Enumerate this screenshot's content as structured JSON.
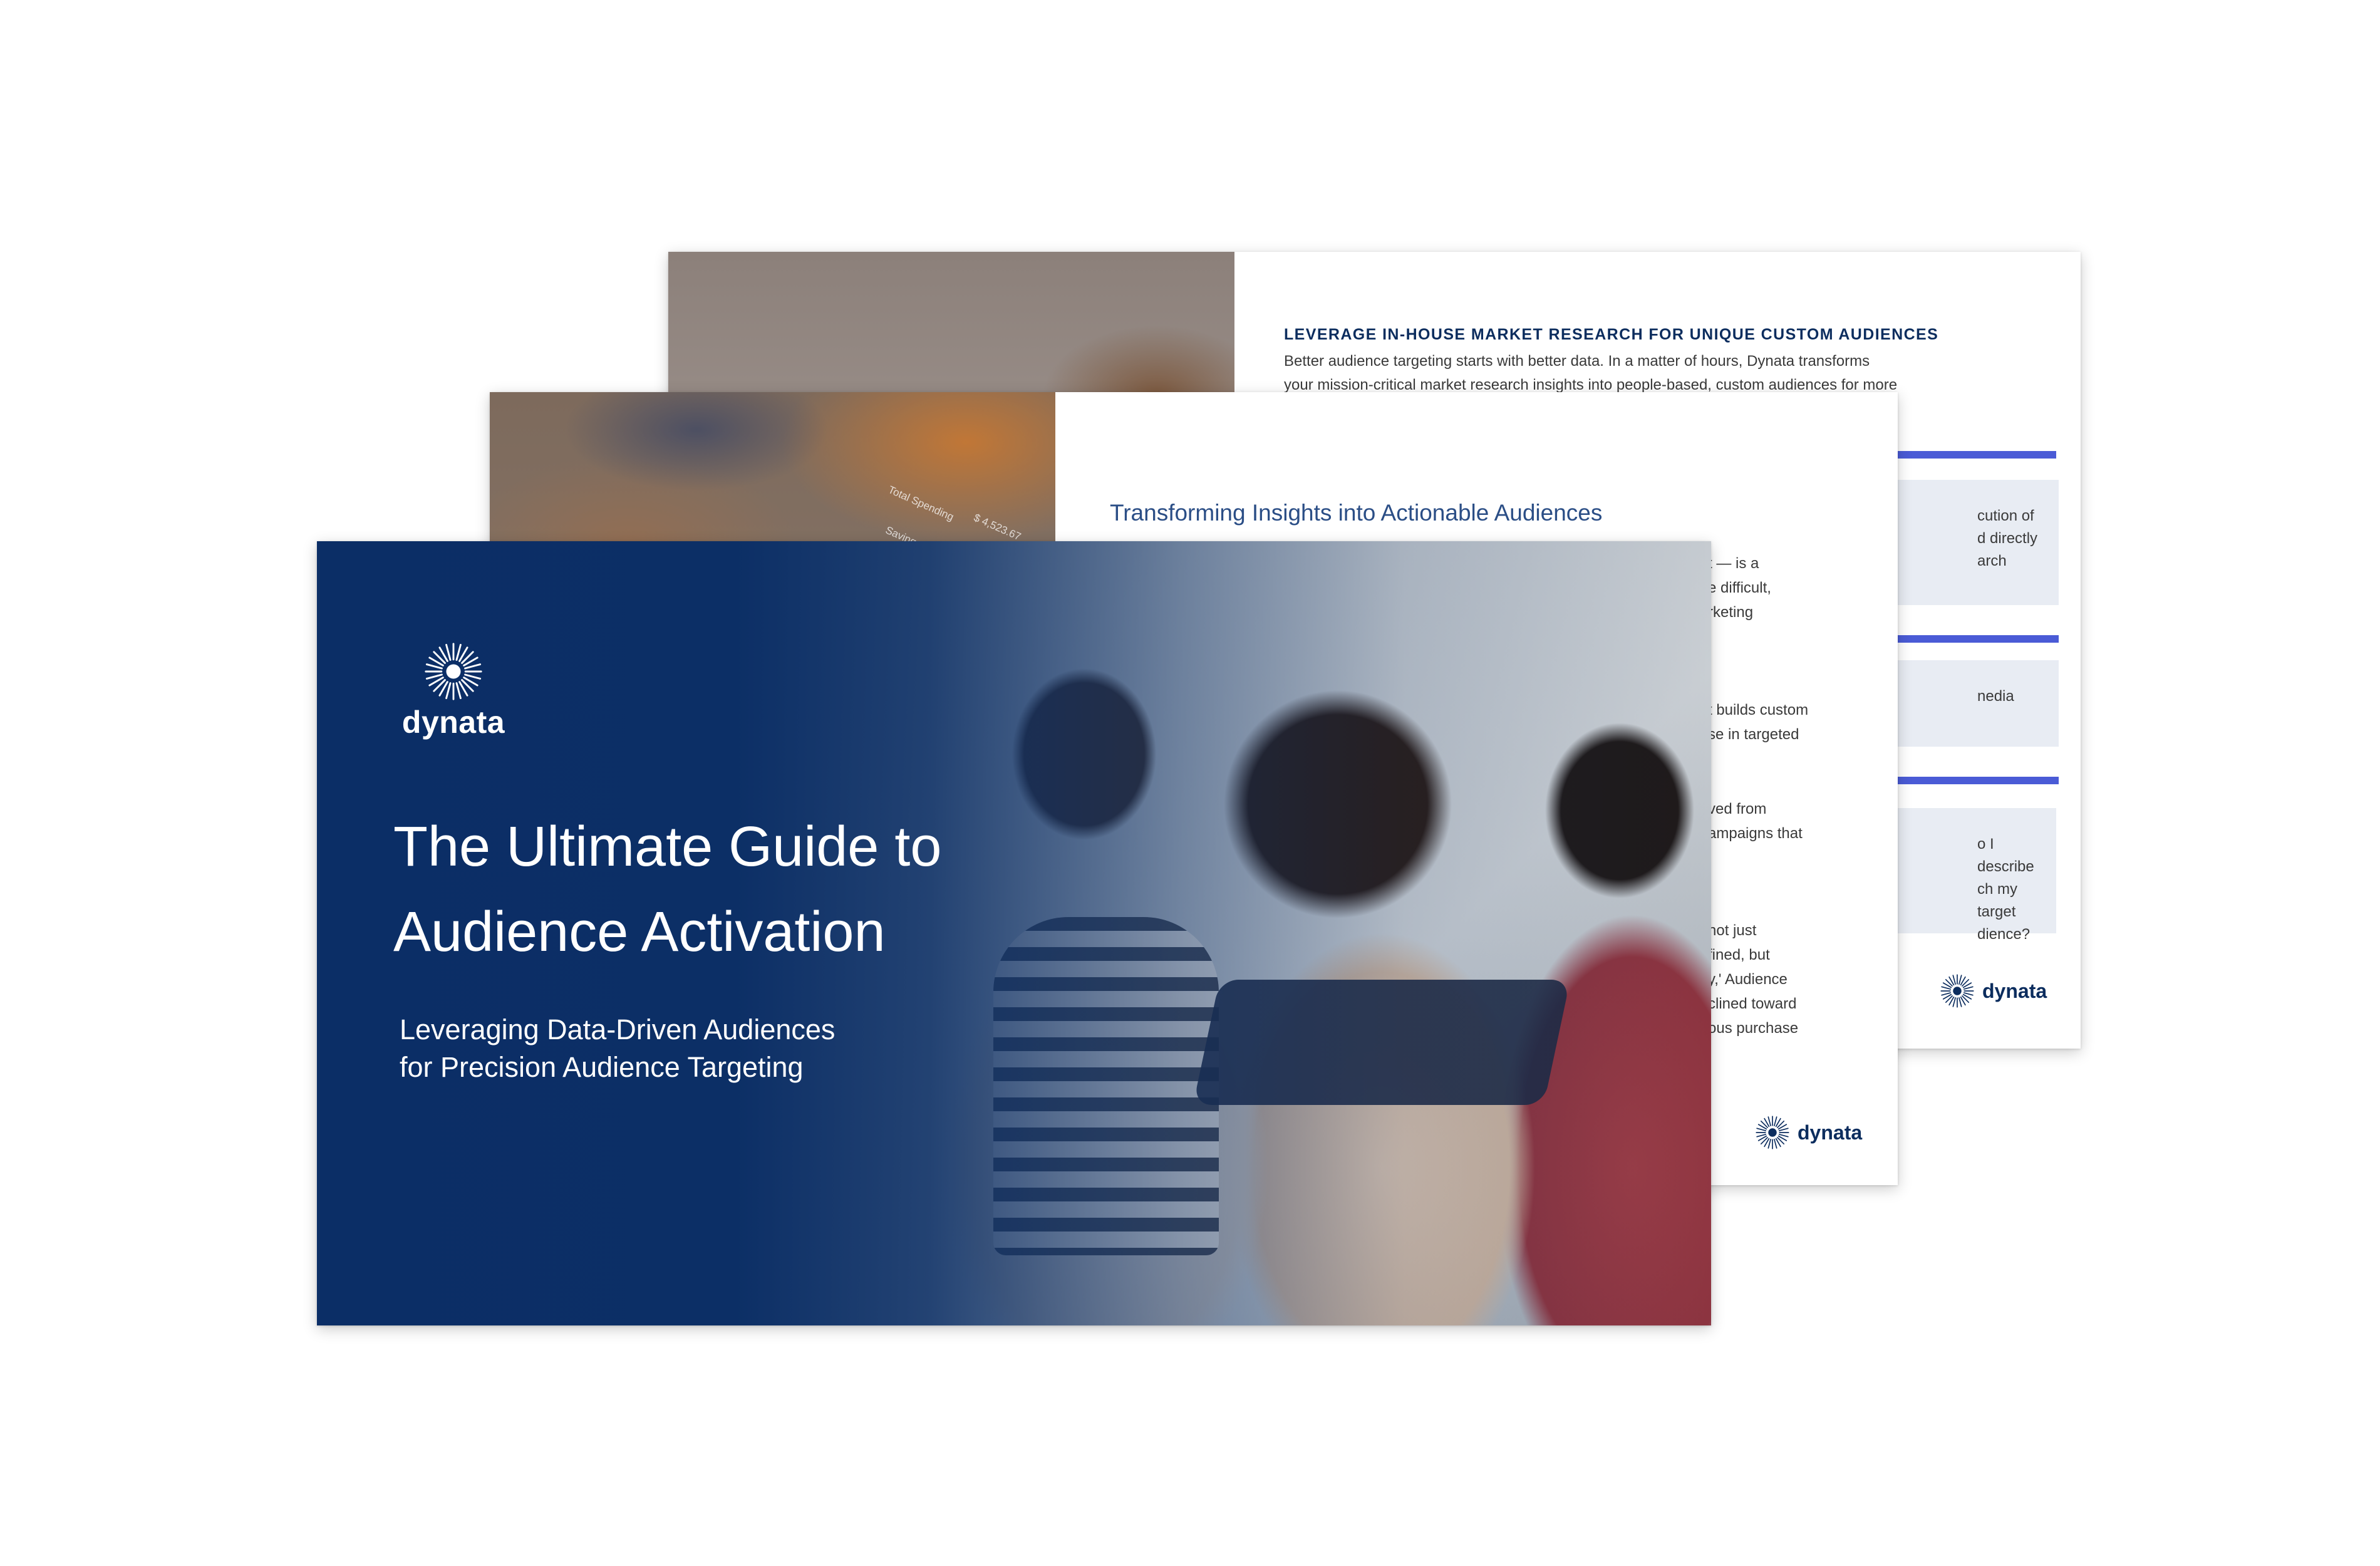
{
  "brand": {
    "name": "dynata",
    "navy": "#0c2d5e",
    "accent_bar": "#4a5bd6",
    "box_fill": "#e8ecf3",
    "logo_icon": "starburst-icon"
  },
  "back_page": {
    "heading": "LEVERAGE IN-HOUSE MARKET RESEARCH FOR UNIQUE CUSTOM AUDIENCES",
    "body_line_1": "Better audience targeting starts with better data. In a matter of hours, Dynata transforms",
    "body_line_2": "your mission-critical market research insights into people-based, custom audiences for more",
    "box_1": "cution of\nd directly\narch",
    "box_2": "nedia",
    "box_3": "o I describe\nch my target\ndience?",
    "logo_text": "dynata"
  },
  "middle_page": {
    "title": "Transforming Insights into Actionable Audiences",
    "photo_label_1": "Total Spending",
    "photo_label_2": "$ 4,523.67",
    "photo_label_3": "Savings",
    "frag_1": "t — is a\ne difficult,\nrketing",
    "frag_2": "t builds custom\nse in targeted",
    "frag_3": "ved from\nampaigns that",
    "frag_4": "not just\nfined, but\ny,' Audience\nclined toward\nous purchase",
    "logo_text": "dynata"
  },
  "cover": {
    "logo_text": "dynata",
    "title_line_1": "The Ultimate Guide to",
    "title_line_2": "Audience Activation",
    "subtitle_line_1": "Leveraging Data-Driven Audiences",
    "subtitle_line_2": "for Precision Audience Targeting"
  }
}
